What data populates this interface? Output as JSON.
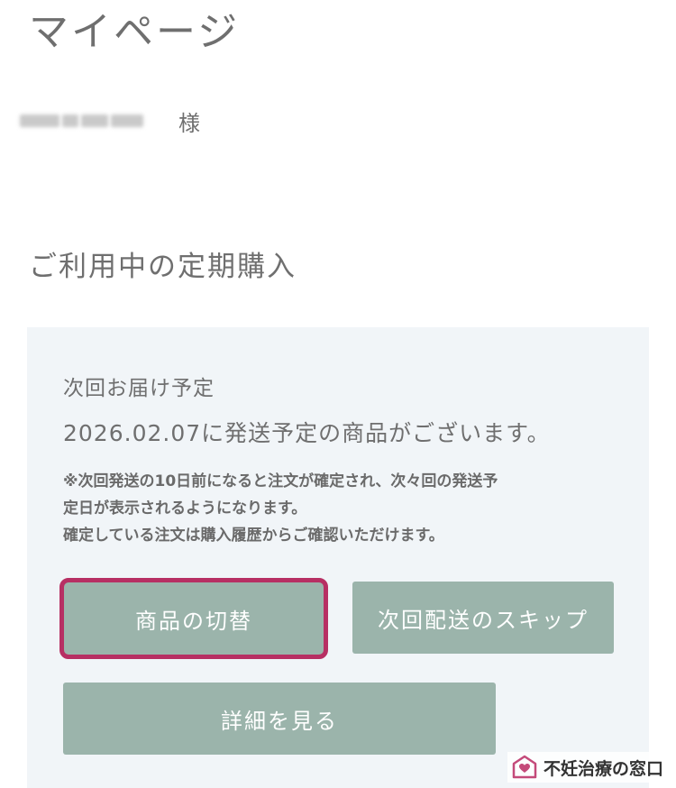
{
  "header": {
    "title": "マイページ"
  },
  "user": {
    "honorific": "様"
  },
  "subscription": {
    "section_title": "ご利用中の定期購入",
    "next_delivery_label": "次回お届け予定",
    "shipping_message": "2026.02.07に発送予定の商品がございます。",
    "notes": [
      "※次回発送の10日前になると注文が確定され、次々回の発送予",
      "定日が表示されるようになります。",
      "確定している注文は購入履歴からご確認いただけます。"
    ],
    "buttons": {
      "switch_product": "商品の切替",
      "skip_next": "次回配送のスキップ",
      "view_details": "詳細を見る"
    },
    "highlight_color": "#b72f63",
    "button_color": "#9bb4ab"
  },
  "watermark": {
    "text": "不妊治療の窓口",
    "icon": "house-heart-logo-icon"
  }
}
